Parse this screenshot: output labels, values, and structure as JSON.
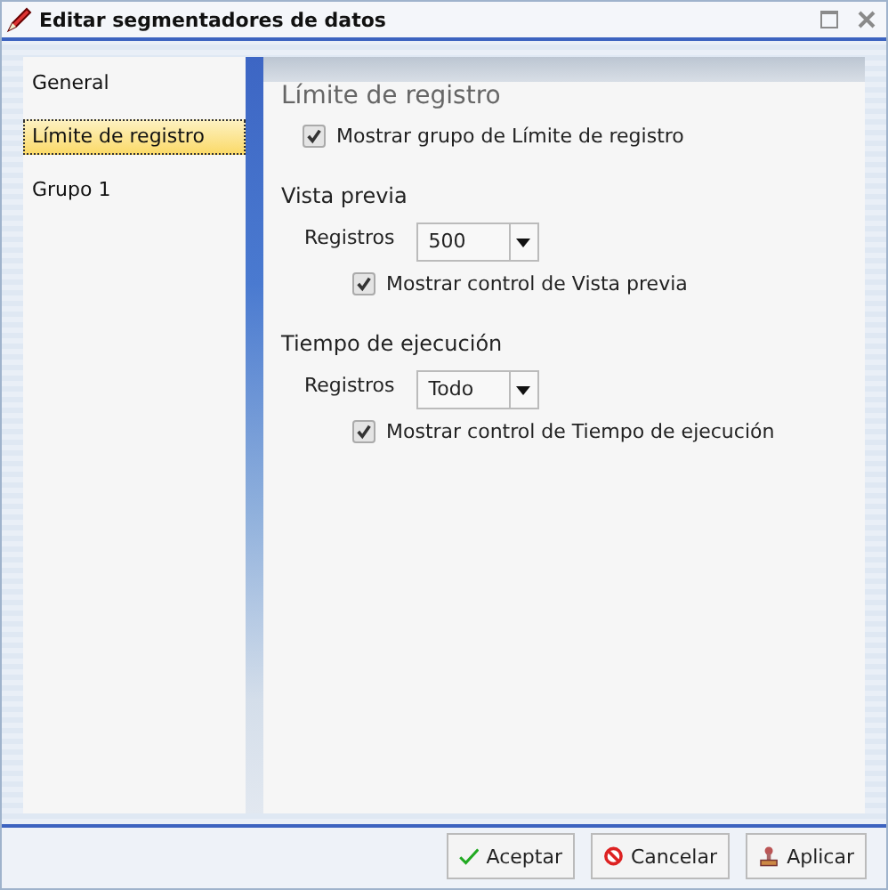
{
  "window": {
    "title": "Editar segmentadores de datos"
  },
  "nav": [
    {
      "label": "General",
      "selected": false
    },
    {
      "label": "Límite de registro",
      "selected": true
    },
    {
      "label": "Grupo 1",
      "selected": false
    }
  ],
  "header": {
    "title": "Límite de registro",
    "checkbox": {
      "label": "Mostrar grupo de Límite de registro",
      "checked": true
    }
  },
  "groups": [
    {
      "title": "Vista previa",
      "field_label": "Registros",
      "value": "500",
      "checkbox": {
        "label": "Mostrar control de Vista previa",
        "checked": true
      }
    },
    {
      "title": "Tiempo de ejecución",
      "field_label": "Registros",
      "value": "Todo",
      "checkbox": {
        "label": "Mostrar control de Tiempo de ejecución",
        "checked": true
      }
    }
  ],
  "buttons": [
    {
      "label": "Aceptar",
      "kind": "accept"
    },
    {
      "label": "Cancelar",
      "kind": "cancel"
    },
    {
      "label": "Aplicar",
      "kind": "apply"
    }
  ]
}
